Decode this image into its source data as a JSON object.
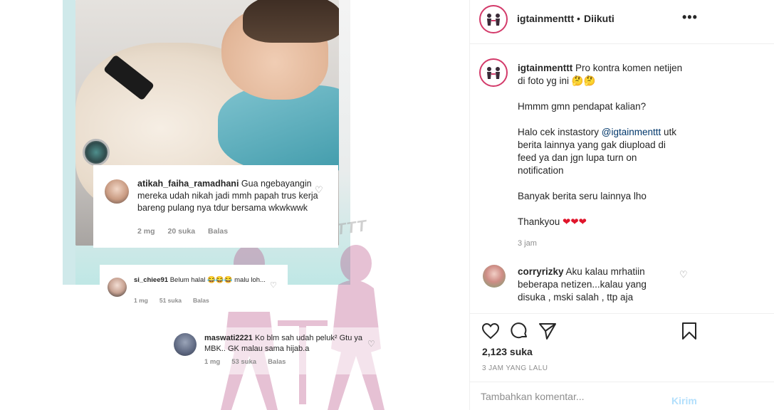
{
  "post_image": {
    "watermark": "IGTAINMENTTT",
    "comments": [
      {
        "user": "atikah_faiha_ramadhani",
        "text": "Gua ngebayangin mereka udah nikah  jadi mmh papah trus kerja bareng pulang nya tdur bersama wkwkwwk",
        "time": "2 mg",
        "likes": "20 suka",
        "reply": "Balas"
      },
      {
        "user": "si_chiee91",
        "text": "Belum halal 😂😂😂 malu loh...",
        "time": "1 mg",
        "likes": "51 suka",
        "reply": "Balas"
      },
      {
        "user": "maswati2221",
        "text": "Ko blm sah udah peluk² Gtu ya MBK.. GK malau sama hijab.a",
        "time": "1 mg",
        "likes": "53 suka",
        "reply": "Balas"
      }
    ]
  },
  "header": {
    "username": "igtainmenttt",
    "separator": "•",
    "follow_status": "Diikuti",
    "more": "•••"
  },
  "caption": {
    "username": "igtainmenttt",
    "line1": "Pro kontra komen netijen di foto yg ini 🤔🤔",
    "line2": "Hmmm gmn pendapat kalian?",
    "line3_pre": "Halo cek instastory ",
    "mention": "@igtainmenttt",
    "line3_post": " utk berita lainnya yang gak diupload di feed ya dan jgn lupa turn on notification",
    "line4": "Banyak berita seru lainnya lho",
    "line5": "Thankyou ",
    "hearts": "❤❤❤",
    "time": "3 jam"
  },
  "comment": {
    "username": "corryrizky",
    "text": " Aku kalau mrhatiin beberapa netizen...kalau yang disuka , mski salah , ttp aja"
  },
  "actions": {
    "likes": "2,123 suka",
    "posted": "3 JAM YANG LALU"
  },
  "add_comment": {
    "placeholder": "Tambahkan komentar...",
    "post_label": "Kirim"
  },
  "colors": {
    "accent_link": "#00376b",
    "post_button_disabled": "#b2dffc",
    "heart": "#e0152b",
    "muted": "#8e8e8e"
  }
}
